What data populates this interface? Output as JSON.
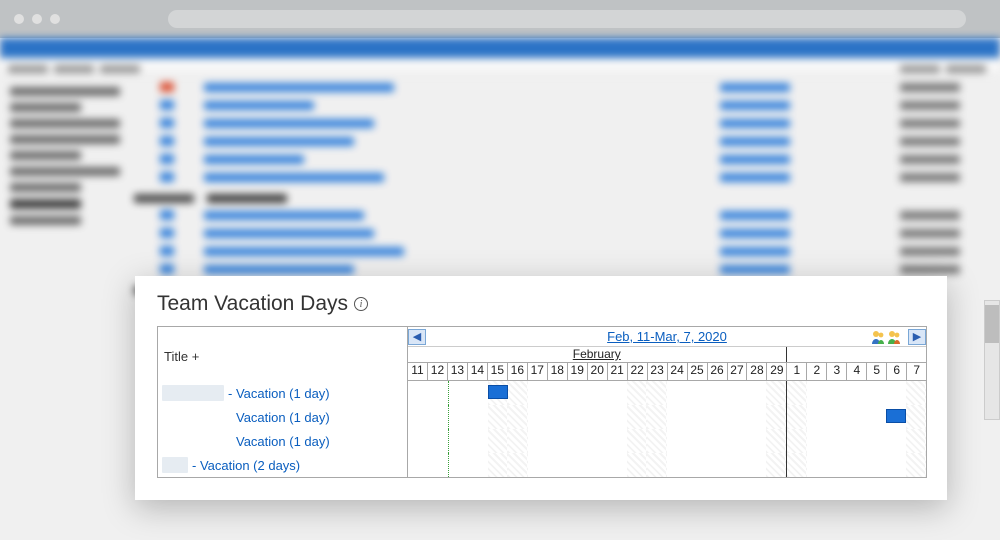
{
  "panel": {
    "title": "Team Vacation Days",
    "info_icon": "i",
    "range_label": "Feb, 11-Mar, 7, 2020",
    "months": {
      "left": "February",
      "right": ""
    },
    "nav": {
      "prev": "◀",
      "next": "▶"
    },
    "title_header": "Title +",
    "days": [
      "11",
      "12",
      "13",
      "14",
      "15",
      "16",
      "17",
      "18",
      "19",
      "20",
      "21",
      "22",
      "23",
      "24",
      "25",
      "26",
      "27",
      "28",
      "29",
      "1",
      "2",
      "3",
      "4",
      "5",
      "6",
      "7"
    ],
    "weekend_cols": [
      4,
      5,
      11,
      12,
      18,
      19,
      25,
      26
    ],
    "today_col": 2,
    "monthsep_col": 19,
    "rows": [
      {
        "prefix_redacted_w": 62,
        "dash": "- ",
        "label": "Vacation (1 day)",
        "bar_col": 4,
        "bar_span": 1
      },
      {
        "prefix_redacted_w": 0,
        "dash": "",
        "label": "Vacation (1 day)",
        "bar_col": 24,
        "bar_span": 1
      },
      {
        "prefix_redacted_w": 0,
        "dash": "",
        "label": "Vacation (1 day)",
        "bar_col": null,
        "bar_span": 0
      },
      {
        "prefix_redacted_w": 26,
        "dash": "- ",
        "label": "Vacation (2 days)",
        "bar_col": null,
        "bar_span": 0
      }
    ]
  }
}
